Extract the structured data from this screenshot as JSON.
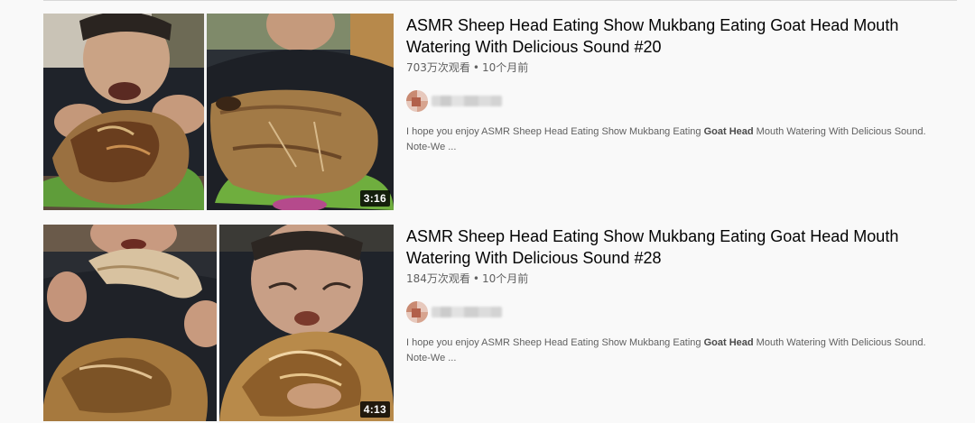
{
  "results": [
    {
      "title": "ASMR Sheep Head Eating Show Mukbang Eating Goat Head Mouth Watering With Delicious Sound #20",
      "views": "703万次观看",
      "separator": "•",
      "age": "10个月前",
      "duration": "3:16",
      "desc_before": "I hope you enjoy ASMR Sheep Head Eating Show Mukbang Eating ",
      "desc_bold": "Goat Head",
      "desc_after": " Mouth Watering With Delicious Sound. Note-We ..."
    },
    {
      "title": "ASMR Sheep Head Eating Show Mukbang Eating Goat Head Mouth Watering With Delicious Sound #28",
      "views": "184万次观看",
      "separator": "•",
      "age": "10个月前",
      "duration": "4:13",
      "desc_before": "I hope you enjoy ASMR Sheep Head Eating Show Mukbang Eating ",
      "desc_bold": "Goat Head",
      "desc_after": " Mouth Watering With Delicious Sound. Note-We ..."
    }
  ],
  "colors": {
    "background": "#f9f9f9",
    "title_text": "#030303",
    "meta_text": "#606060",
    "duration_badge": "#000000"
  },
  "icons": {
    "thumbnail": "video-thumbnail-image",
    "avatar": "channel-avatar-blurred"
  }
}
